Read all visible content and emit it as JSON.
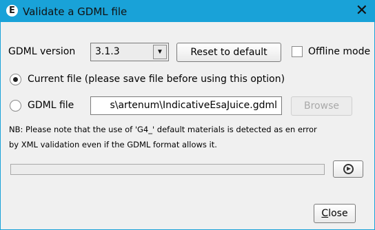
{
  "window": {
    "title": "Validate a GDML file",
    "app_icon_letter": "E",
    "close_glyph": "✕",
    "accent_color": "#19a2d8"
  },
  "version_row": {
    "label": "GDML version",
    "selected_version": "3.1.3",
    "reset_button": "Reset to default",
    "offline_label": "Offline mode",
    "offline_checked": false
  },
  "radio_current": {
    "label": "Current file (please save file before using this option)",
    "selected": true
  },
  "radio_file": {
    "label": "GDML file",
    "selected": false,
    "path_value": "s\\artenum\\IndicativeEsaJuice.gdml",
    "browse_button": "Browse"
  },
  "note": {
    "line1": "NB: Please note that the use of 'G4_' default materials is detected as en error",
    "line2": "by XML validation even if the GDML format allows it."
  },
  "progress": {
    "value": 0
  },
  "run_button_icon": "play-circle-icon",
  "close_button": {
    "first_letter": "C",
    "rest": "lose"
  }
}
